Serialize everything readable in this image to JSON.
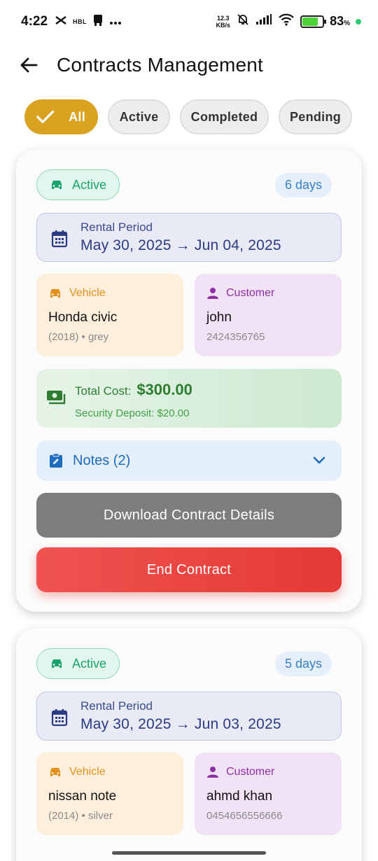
{
  "status_bar": {
    "time": "4:22",
    "carrier_badge": "HBL",
    "speed_value": "12.3",
    "speed_unit": "KB/s",
    "battery_percent": "83",
    "battery_unit": "%",
    "dot_color": "#2ecc71"
  },
  "header": {
    "title": "Contracts Management",
    "back_icon": "arrow-left-icon"
  },
  "filters": [
    {
      "label": "All",
      "selected": true
    },
    {
      "label": "Active",
      "selected": false
    },
    {
      "label": "Completed",
      "selected": false
    },
    {
      "label": "Pending",
      "selected": false
    }
  ],
  "contracts": [
    {
      "status": "Active",
      "duration": "6 days",
      "period_label": "Rental Period",
      "period_dates": "May 30, 2025 → Jun 04, 2025",
      "vehicle": {
        "label": "Vehicle",
        "name": "Honda civic",
        "details": "(2018) • grey"
      },
      "customer": {
        "label": "Customer",
        "name": "john",
        "phone": "2424356765"
      },
      "total_cost_label": "Total Cost:",
      "total_cost": "$300.00",
      "security_deposit": "Security Deposit: $20.00",
      "notes_label": "Notes (2)",
      "download_button": "Download Contract Details",
      "end_button": "End Contract"
    },
    {
      "status": "Active",
      "duration": "5 days",
      "period_label": "Rental Period",
      "period_dates": "May 30, 2025 → Jun 03, 2025",
      "vehicle": {
        "label": "Vehicle",
        "name": "nissan note",
        "details": "(2014) • silver"
      },
      "customer": {
        "label": "Customer",
        "name": "ahmd khan",
        "phone": "0454656556666"
      }
    }
  ],
  "colors": {
    "accent": "#d9a321",
    "active_green": "#1aa36b",
    "danger": "#e53935",
    "neutral_button": "#7d7d7d"
  }
}
